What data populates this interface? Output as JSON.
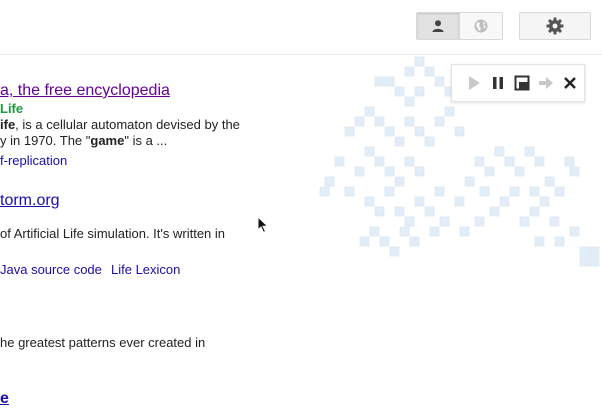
{
  "results": [
    {
      "title": "a, the free encyclopedia",
      "url": "Life",
      "snippet1_bold": "ife",
      "snippet1_rest": ", is a cellular automaton devised by the",
      "snippet2_pre": "y in 1970. The \"",
      "snippet2_bold": "game",
      "snippet2_post": "\" is a ...",
      "sublink": "f-replication"
    },
    {
      "title": "torm.org",
      "snippet1": " of Artificial Life simulation. It's written in",
      "sublink1": "Java source code",
      "sublink2": "Life Lexicon"
    },
    {
      "snippet1": "he greatest patterns ever created in"
    },
    {
      "title": "e"
    }
  ],
  "toolbar": {
    "person_icon": "person-icon",
    "globe_icon": "globe-icon",
    "settings_icon": "gear-icon"
  },
  "player": {
    "play_icon": "play-icon",
    "pause_icon": "pause-icon",
    "window_icon": "window-icon",
    "step_icon": "step-forward-icon",
    "close_icon": "close-icon"
  }
}
